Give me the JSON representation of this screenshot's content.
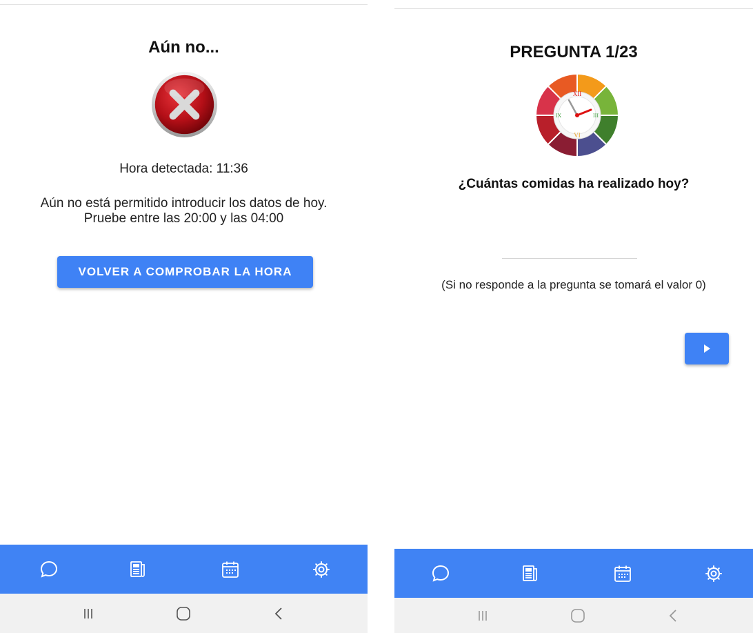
{
  "left": {
    "title": "Aún no...",
    "detected_time": "Hora detectada: 11:36",
    "message": "Aún no está permitido introducir los datos de hoy. Pruebe entre las 20:00 y las 04:00",
    "recheck_button": "VOLVER A COMPROBAR LA HORA"
  },
  "right": {
    "title": "PREGUNTA 1/23",
    "question": "¿Cuántas comidas ha realizado hoy?",
    "answer_value": "",
    "hint": "(Si no responde a la pregunta se tomará el valor 0)",
    "clock_numerals": [
      "XII",
      "III",
      "VI",
      "IX"
    ]
  },
  "nav_tabs": [
    {
      "icon": "chat-bubble-icon"
    },
    {
      "icon": "news-icon"
    },
    {
      "icon": "calendar-icon"
    },
    {
      "icon": "settings-icon"
    }
  ],
  "system_nav": [
    {
      "icon": "recent-apps-icon"
    },
    {
      "icon": "home-icon"
    },
    {
      "icon": "back-icon"
    }
  ],
  "colors": {
    "accent": "#3f82f5",
    "tabbar": "#4083f4",
    "error_red": "#c0121b"
  }
}
